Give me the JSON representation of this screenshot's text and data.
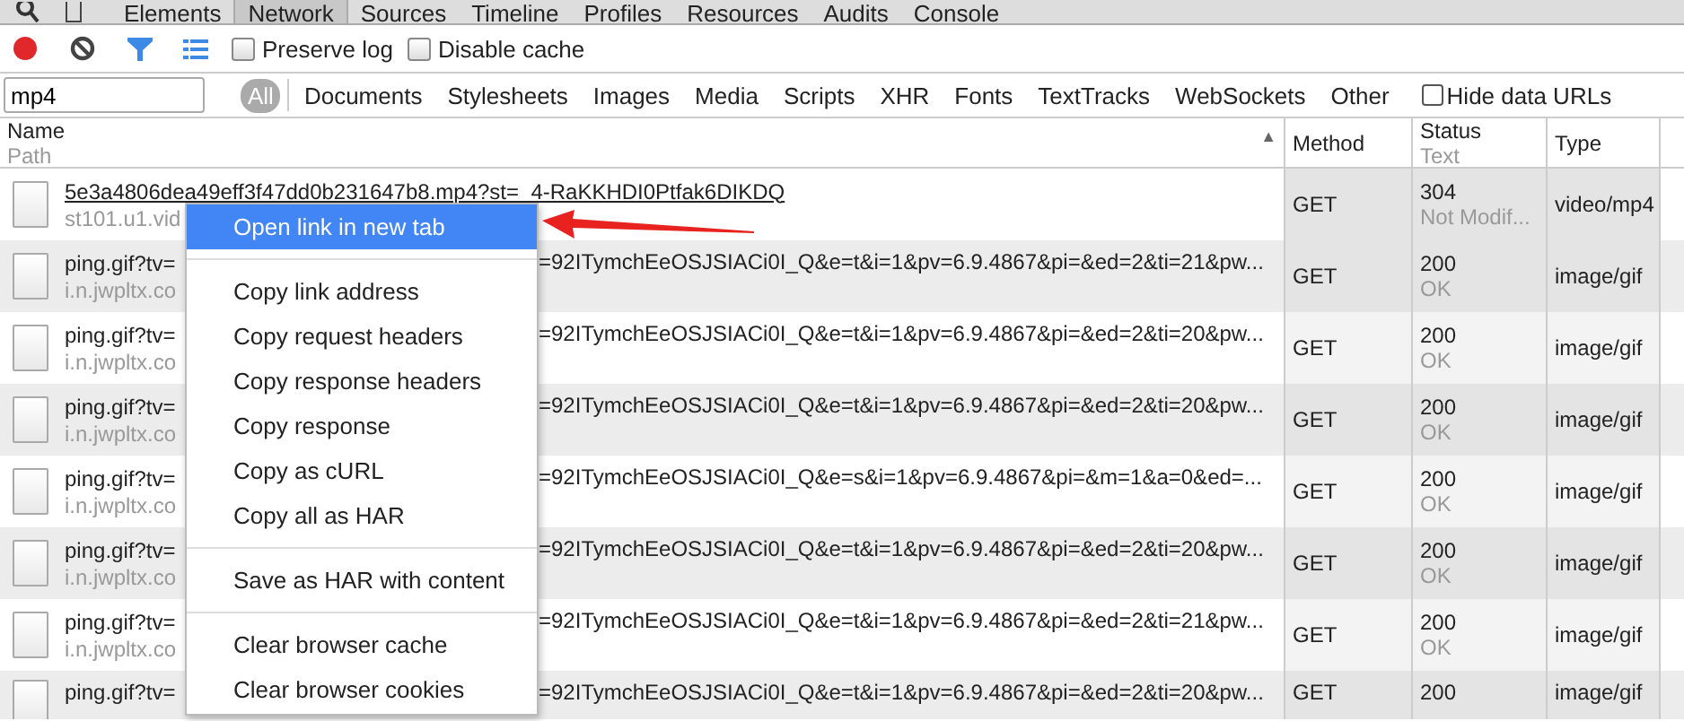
{
  "panel_tabs": [
    {
      "label": "Elements",
      "selected": false
    },
    {
      "label": "Network",
      "selected": true
    },
    {
      "label": "Sources",
      "selected": false
    },
    {
      "label": "Timeline",
      "selected": false
    },
    {
      "label": "Profiles",
      "selected": false
    },
    {
      "label": "Resources",
      "selected": false
    },
    {
      "label": "Audits",
      "selected": false
    },
    {
      "label": "Console",
      "selected": false
    }
  ],
  "toolbar": {
    "recording": true,
    "checkboxes": [
      {
        "label": "Preserve log",
        "checked": false
      },
      {
        "label": "Disable cache",
        "checked": false
      }
    ]
  },
  "filter_bar": {
    "search": {
      "value": "mp4"
    },
    "types": [
      {
        "label": "All",
        "selected": true
      },
      {
        "label": "Documents",
        "selected": false
      },
      {
        "label": "Stylesheets",
        "selected": false
      },
      {
        "label": "Images",
        "selected": false
      },
      {
        "label": "Media",
        "selected": false
      },
      {
        "label": "Scripts",
        "selected": false
      },
      {
        "label": "XHR",
        "selected": false
      },
      {
        "label": "Fonts",
        "selected": false
      },
      {
        "label": "TextTracks",
        "selected": false
      },
      {
        "label": "WebSockets",
        "selected": false
      },
      {
        "label": "Other",
        "selected": false
      }
    ],
    "hide_data_urls": {
      "label": "Hide data URLs",
      "checked": false
    }
  },
  "table": {
    "columns": [
      {
        "title": "Name",
        "subtitle": "Path",
        "sort_mark": "▲"
      },
      {
        "title": "Method"
      },
      {
        "title": "Status",
        "subtitle": "Text"
      },
      {
        "title": "Type"
      }
    ],
    "rows": [
      {
        "hovered": true,
        "name": "5e3a4806dea49eff3f47dd0b231647b8.mp4?st=_4-RaKKHDI0Ptfak6DIKDQ",
        "path": "st101.u1.vid",
        "method": "GET",
        "status": "304",
        "status_text": "Not Modif...",
        "type": "video/mp4"
      },
      {
        "hovered": false,
        "name": "ping.gif?tv=",
        "name_tail": "=92ITymchEeOSJSIACi0I_Q&e=t&i=1&pv=6.9.4867&pi=&ed=2&ti=21&pw...",
        "path": "i.n.jwpltx.co",
        "method": "GET",
        "status": "200",
        "status_text": "OK",
        "type": "image/gif"
      },
      {
        "hovered": false,
        "name": "ping.gif?tv=",
        "name_tail": "=92ITymchEeOSJSIACi0I_Q&e=t&i=1&pv=6.9.4867&pi=&ed=2&ti=20&pw...",
        "path": "i.n.jwpltx.co",
        "method": "GET",
        "status": "200",
        "status_text": "OK",
        "type": "image/gif"
      },
      {
        "hovered": false,
        "name": "ping.gif?tv=",
        "name_tail": "=92ITymchEeOSJSIACi0I_Q&e=t&i=1&pv=6.9.4867&pi=&ed=2&ti=20&pw...",
        "path": "i.n.jwpltx.co",
        "method": "GET",
        "status": "200",
        "status_text": "OK",
        "type": "image/gif"
      },
      {
        "hovered": false,
        "name": "ping.gif?tv=",
        "name_tail": "=92ITymchEeOSJSIACi0I_Q&e=s&i=1&pv=6.9.4867&pi=&m=1&a=0&ed=...",
        "path": "i.n.jwpltx.co",
        "method": "GET",
        "status": "200",
        "status_text": "OK",
        "type": "image/gif"
      },
      {
        "hovered": false,
        "name": "ping.gif?tv=",
        "name_tail": "=92ITymchEeOSJSIACi0I_Q&e=t&i=1&pv=6.9.4867&pi=&ed=2&ti=20&pw...",
        "path": "i.n.jwpltx.co",
        "method": "GET",
        "status": "200",
        "status_text": "OK",
        "type": "image/gif"
      },
      {
        "hovered": false,
        "name": "ping.gif?tv=",
        "name_tail": "=92ITymchEeOSJSIACi0I_Q&e=t&i=1&pv=6.9.4867&pi=&ed=2&ti=21&pw...",
        "path": "i.n.jwpltx.co",
        "method": "GET",
        "status": "200",
        "status_text": "OK",
        "type": "image/gif"
      },
      {
        "hovered": false,
        "name": "ping.gif?tv=",
        "name_tail": "=92ITymchEeOSJSIACi0I_Q&e=t&i=1&pv=6.9.4867&pi=&ed=2&ti=20&pw...",
        "method": "GET",
        "status": "200",
        "type": "image/gif"
      }
    ]
  },
  "context_menu": {
    "groups": [
      [
        {
          "label": "Open link in new tab",
          "selected": true
        }
      ],
      [
        {
          "label": "Copy link address",
          "selected": false
        },
        {
          "label": "Copy request headers",
          "selected": false
        },
        {
          "label": "Copy response headers",
          "selected": false
        },
        {
          "label": "Copy response",
          "selected": false
        },
        {
          "label": "Copy as cURL",
          "selected": false
        },
        {
          "label": "Copy all as HAR",
          "selected": false
        }
      ],
      [
        {
          "label": "Save as HAR with content",
          "selected": false
        }
      ],
      [
        {
          "label": "Clear browser cache",
          "selected": false
        },
        {
          "label": "Clear browser cookies",
          "selected": false
        }
      ]
    ]
  }
}
